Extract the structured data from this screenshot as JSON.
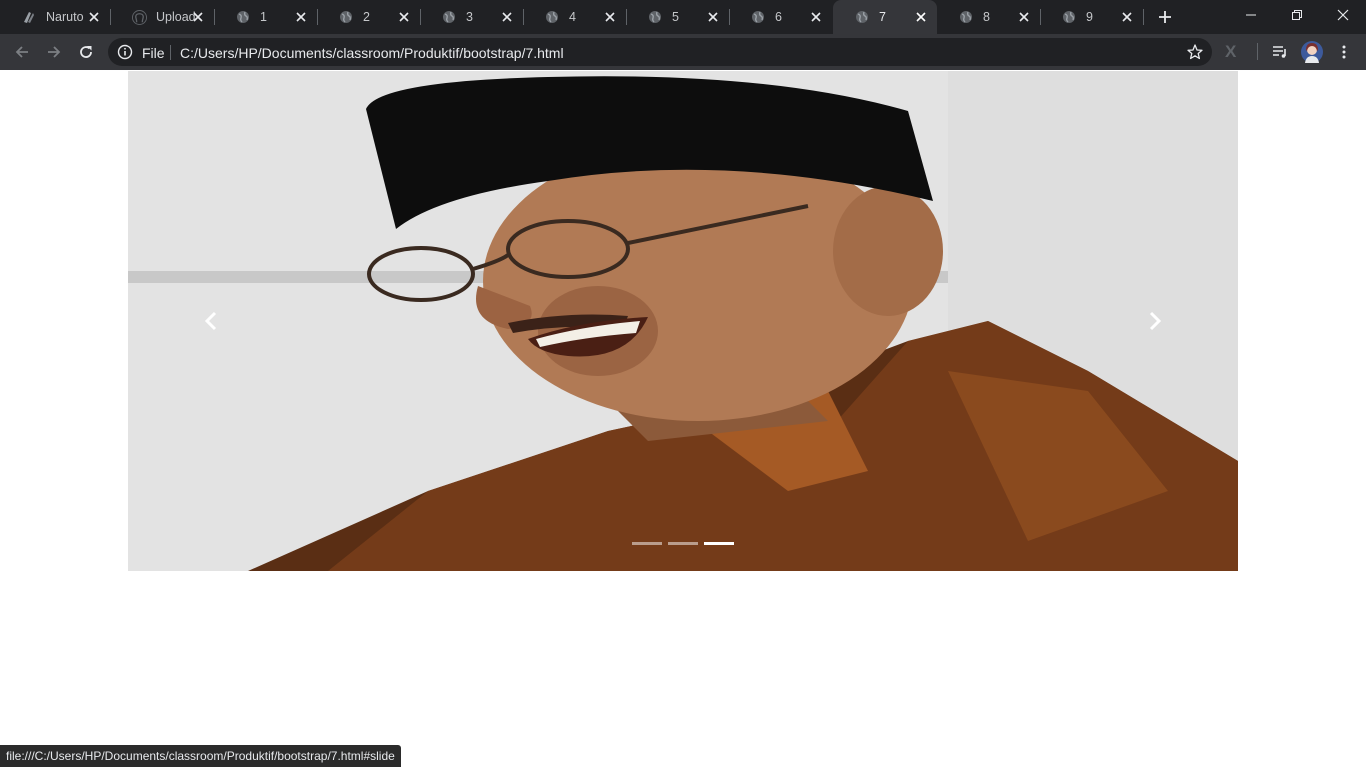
{
  "browser": {
    "tabs": [
      {
        "title": "Naruto",
        "icon": "naruto-favicon-icon"
      },
      {
        "title": "Upload",
        "icon": "github-icon"
      },
      {
        "title": "1",
        "icon": "globe-icon"
      },
      {
        "title": "2",
        "icon": "globe-icon"
      },
      {
        "title": "3",
        "icon": "globe-icon"
      },
      {
        "title": "4",
        "icon": "globe-icon"
      },
      {
        "title": "5",
        "icon": "globe-icon"
      },
      {
        "title": "6",
        "icon": "globe-icon"
      },
      {
        "title": "7",
        "icon": "globe-icon",
        "active": true
      },
      {
        "title": "8",
        "icon": "globe-icon"
      },
      {
        "title": "9",
        "icon": "globe-icon"
      }
    ],
    "omnibox": {
      "scheme_label": "File",
      "url": "C:/Users/HP/Documents/classroom/Produktif/bootstrap/7.html"
    },
    "status_url": "file:///C:/Users/HP/Documents/classroom/Produktif/bootstrap/7.html#slide",
    "colors": {
      "frame": "#202124",
      "toolbar": "#35363a",
      "text": "#e8eaed",
      "icon": "#c5c7ca"
    }
  },
  "carousel": {
    "prev_icon": "chevron-left-icon",
    "next_icon": "chevron-right-icon",
    "slide_count": 3,
    "active_slide": 3
  }
}
